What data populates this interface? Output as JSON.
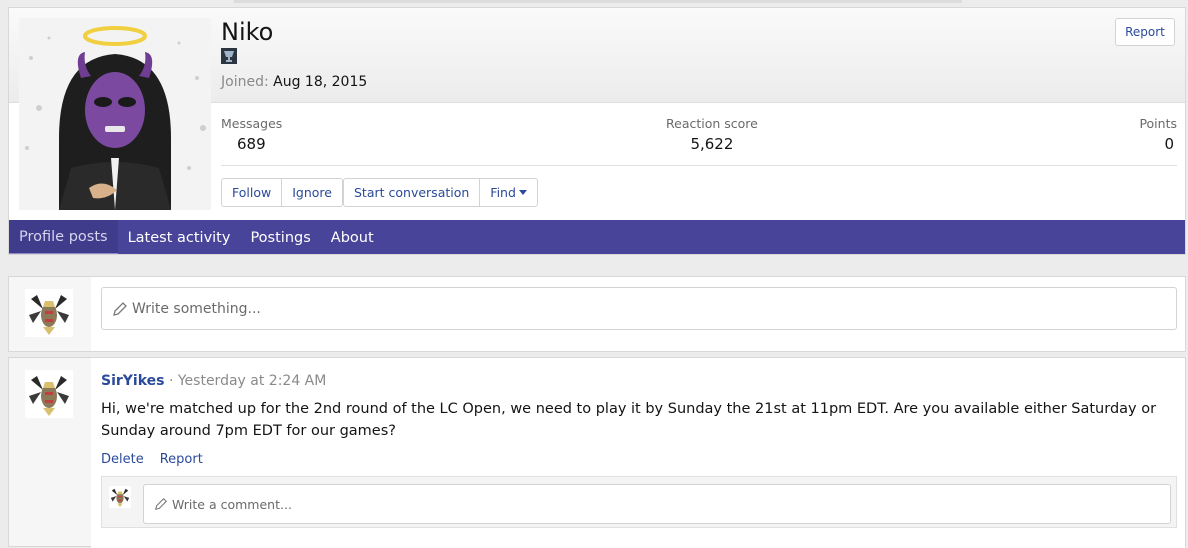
{
  "profile": {
    "username": "Niko",
    "joined_label": "Joined:",
    "joined_date": "Aug 18, 2015",
    "report_label": "Report",
    "stats": {
      "messages_label": "Messages",
      "messages_value": "689",
      "reaction_label": "Reaction score",
      "reaction_value": "5,622",
      "points_label": "Points",
      "points_value": "0"
    },
    "buttons": {
      "follow": "Follow",
      "ignore": "Ignore",
      "start_conversation": "Start conversation",
      "find": "Find"
    }
  },
  "tabs": [
    {
      "label": "Profile posts",
      "active": true
    },
    {
      "label": "Latest activity",
      "active": false
    },
    {
      "label": "Postings",
      "active": false
    },
    {
      "label": "About",
      "active": false
    }
  ],
  "composer": {
    "placeholder": "Write something..."
  },
  "post": {
    "author": "SirYikes",
    "separator": "·",
    "date": "Yesterday at 2:24 AM",
    "body": "Hi, we're matched up for the 2nd round of the LC Open, we need to play it by Sunday the 21st at 11pm EDT. Are you available either Saturday or Sunday around 7pm EDT for our games?",
    "delete_label": "Delete",
    "report_label": "Report",
    "comment_placeholder": "Write a comment..."
  },
  "colors": {
    "nav_bg": "#47449a",
    "link": "#2a4a9a"
  }
}
